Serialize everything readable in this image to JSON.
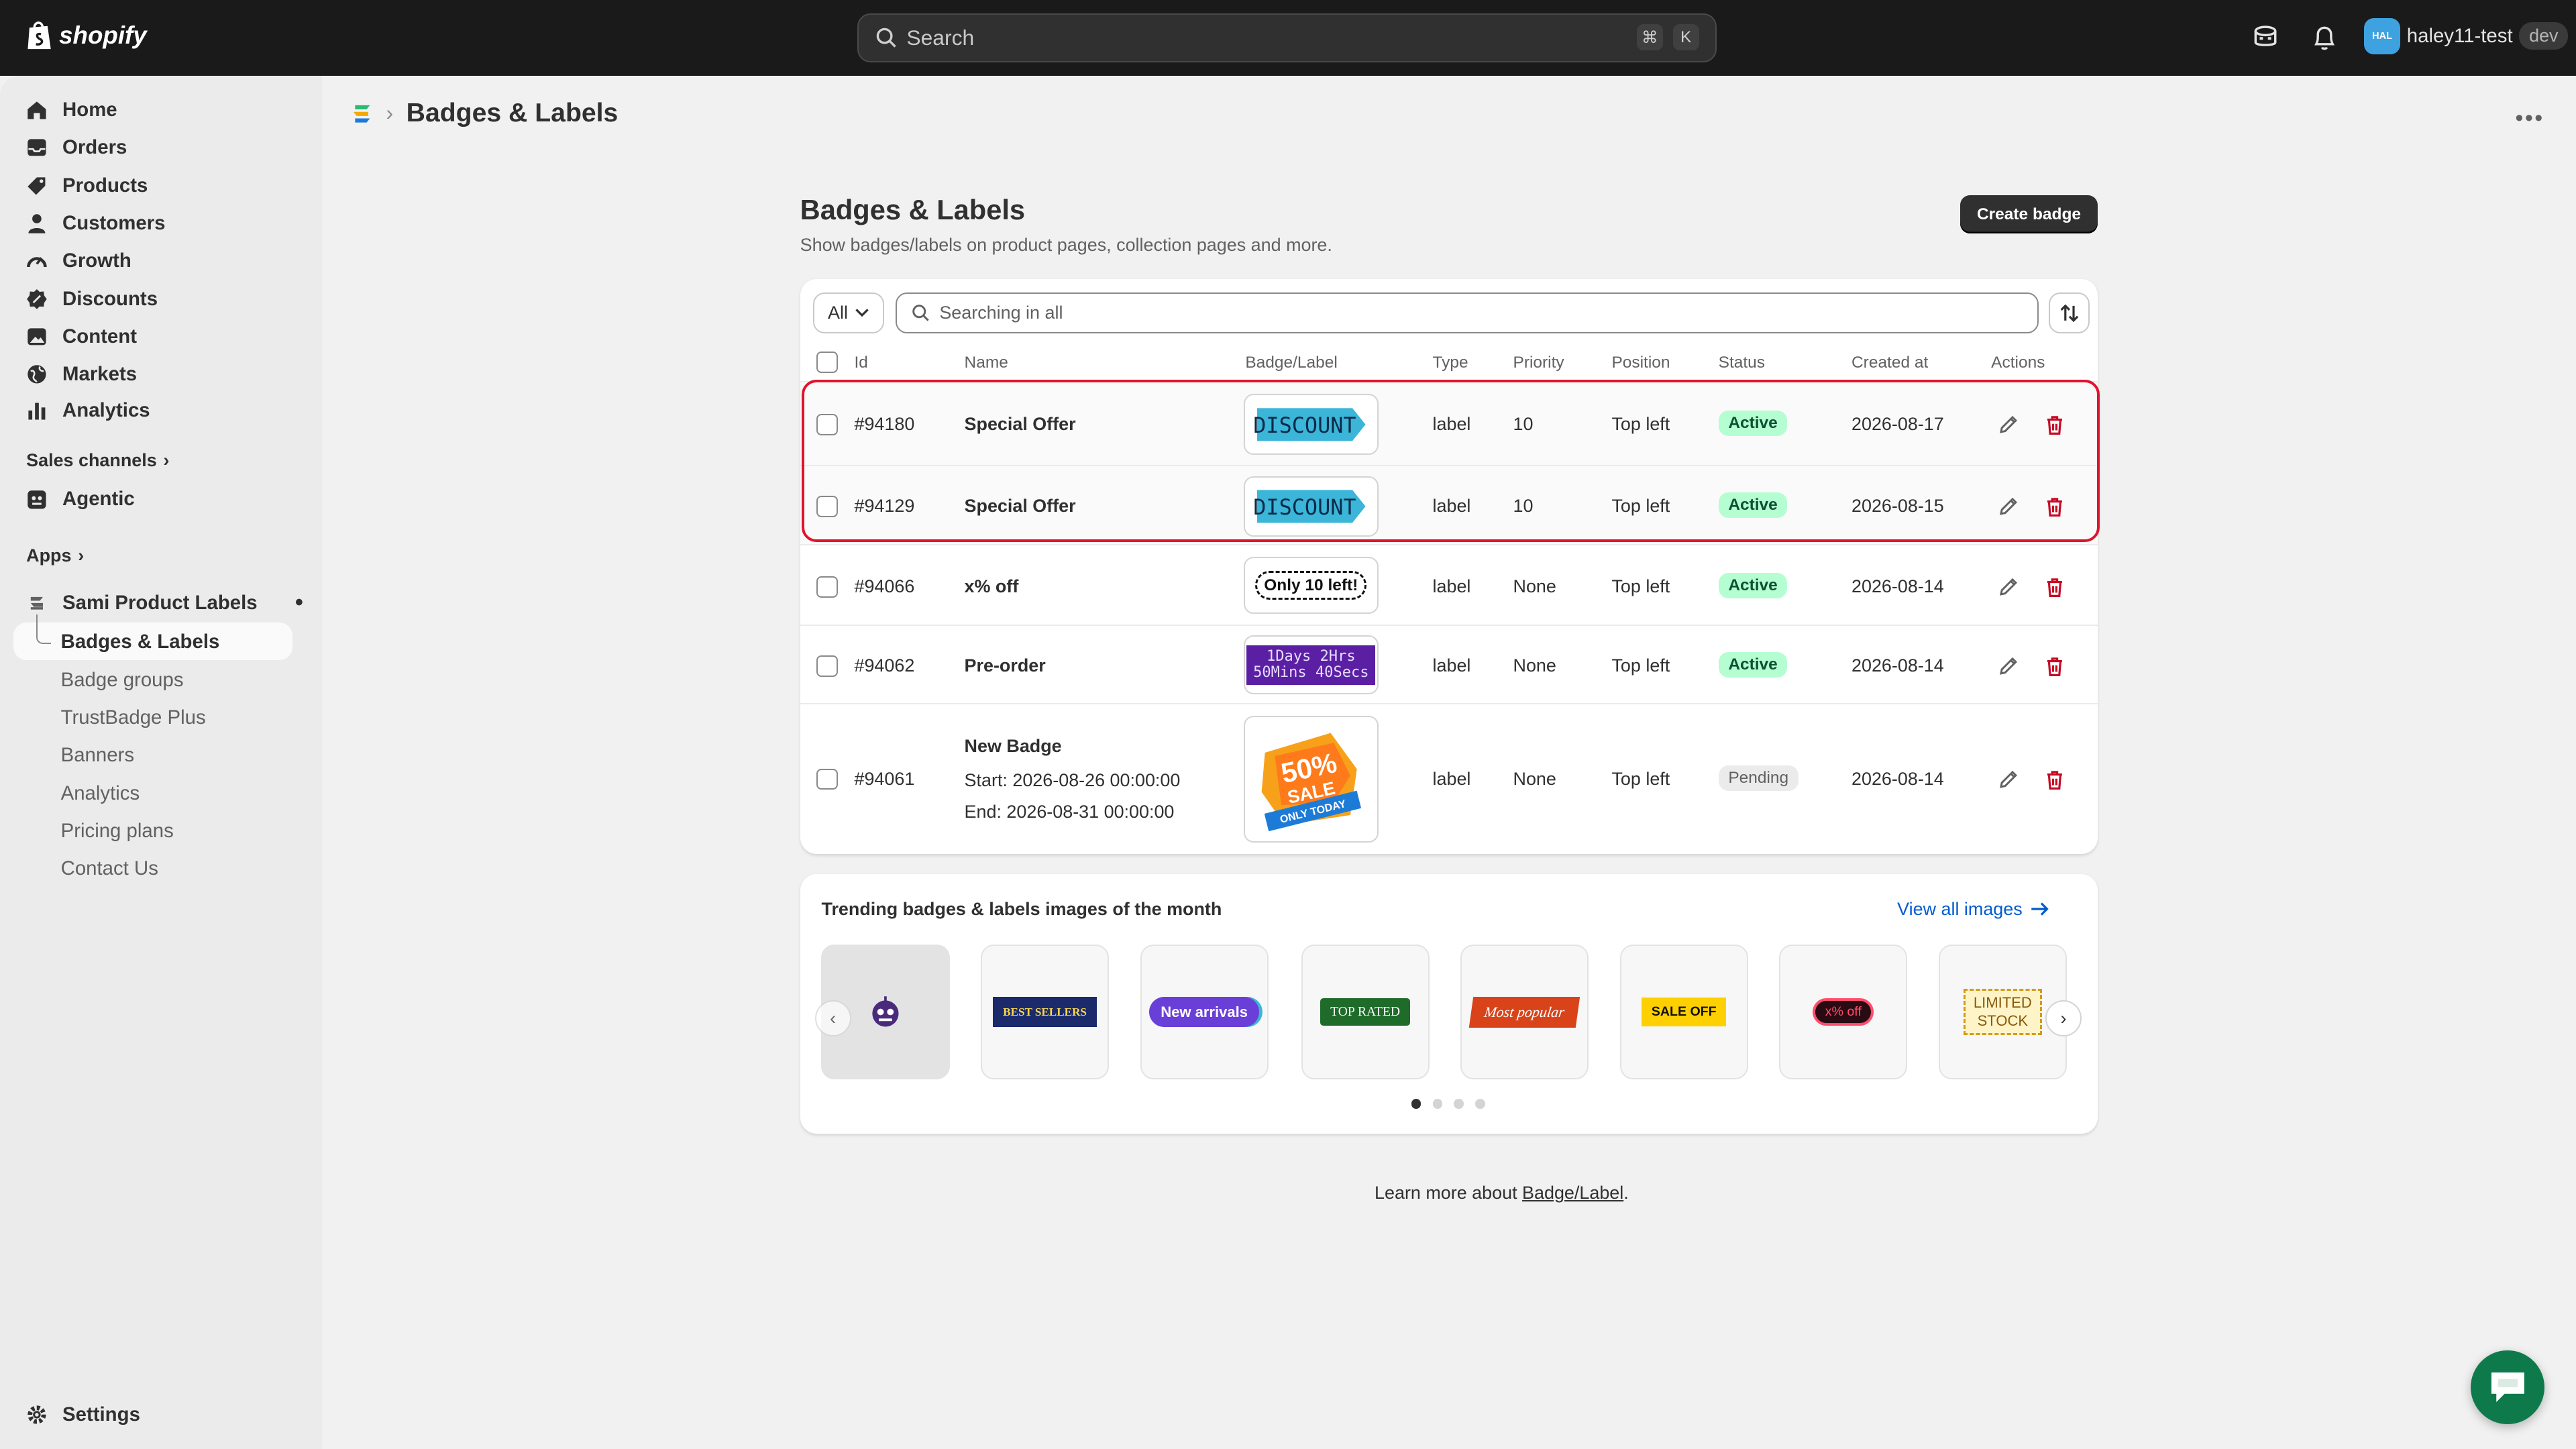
{
  "topbar": {
    "brand": "shopify",
    "search_placeholder": "Search",
    "shortcut_cmd": "⌘",
    "shortcut_key": "K",
    "avatar_initials": "HAL",
    "store_name": "haley11-test",
    "env_badge": "dev"
  },
  "sidebar": {
    "items": [
      {
        "label": "Home",
        "icon": "home-icon"
      },
      {
        "label": "Orders",
        "icon": "inbox-icon"
      },
      {
        "label": "Products",
        "icon": "tag-icon"
      },
      {
        "label": "Customers",
        "icon": "person-icon"
      },
      {
        "label": "Growth",
        "icon": "gauge-icon"
      },
      {
        "label": "Discounts",
        "icon": "discount-icon"
      },
      {
        "label": "Content",
        "icon": "image-icon"
      },
      {
        "label": "Markets",
        "icon": "globe-icon"
      },
      {
        "label": "Analytics",
        "icon": "bar-chart-icon"
      }
    ],
    "sales_channels_label": "Sales channels",
    "agentic_label": "Agentic",
    "apps_label": "Apps",
    "app_name": "Sami Product Labels",
    "app_pages": [
      "Badges & Labels",
      "Badge groups",
      "TrustBadge Plus",
      "Banners",
      "Analytics",
      "Pricing plans",
      "Contact Us"
    ],
    "settings_label": "Settings"
  },
  "page": {
    "breadcrumb": "Badges & Labels",
    "title": "Badges & Labels",
    "subtitle": "Show badges/labels on product pages, collection pages and more.",
    "create_button": "Create badge"
  },
  "table": {
    "filter_value": "All",
    "search_placeholder": "Searching in all",
    "headers": {
      "id": "Id",
      "name": "Name",
      "badge": "Badge/Label",
      "type": "Type",
      "priority": "Priority",
      "position": "Position",
      "status": "Status",
      "created": "Created at",
      "actions": "Actions"
    },
    "rows": [
      {
        "id": "#94180",
        "name": "Special Offer",
        "badge_text": "DISCOUNT",
        "type": "label",
        "priority": "10",
        "position": "Top left",
        "status": "Active",
        "created": "2026-08-17"
      },
      {
        "id": "#94129",
        "name": "Special Offer",
        "badge_text": "DISCOUNT",
        "type": "label",
        "priority": "10",
        "position": "Top left",
        "status": "Active",
        "created": "2026-08-15"
      },
      {
        "id": "#94066",
        "name": "x% off",
        "badge_text": "Only 10 left!",
        "type": "label",
        "priority": "None",
        "position": "Top left",
        "status": "Active",
        "created": "2026-08-14"
      },
      {
        "id": "#94062",
        "name": "Pre-order",
        "badge_line1": "1Days 2Hrs",
        "badge_line2": "50Mins 40Secs",
        "type": "label",
        "priority": "None",
        "position": "Top left",
        "status": "Active",
        "created": "2026-08-14"
      },
      {
        "id": "#94061",
        "name": "New Badge",
        "start": "Start: 2026-08-26 00:00:00",
        "end": "End: 2026-08-31 00:00:00",
        "badge_line1": "50%",
        "badge_line2": "SALE",
        "badge_line3": "ONLY TODAY",
        "type": "label",
        "priority": "None",
        "position": "Top left",
        "status": "Pending",
        "created": "2026-08-14"
      }
    ]
  },
  "trending": {
    "title": "Trending badges & labels images of the month",
    "link": "View all images",
    "thumbs": [
      {
        "text": "",
        "icon": "robot-icon"
      },
      {
        "text": "BEST SELLERS"
      },
      {
        "text": "New arrivals"
      },
      {
        "text": "TOP RATED"
      },
      {
        "text": "Most popular"
      },
      {
        "text": "SALE OFF"
      },
      {
        "text": "x% off"
      },
      {
        "text": "LIMITED",
        "text2": "STOCK"
      }
    ],
    "prev": "‹",
    "next": "›"
  },
  "footer": {
    "learn_prefix": "Learn more about ",
    "learn_link": "Badge/Label",
    "learn_suffix": "."
  },
  "colors": {
    "accent_dark": "#303030",
    "active_green": "#b4fed2",
    "highlight_red": "#e0142d",
    "link_blue": "#005bd3"
  }
}
